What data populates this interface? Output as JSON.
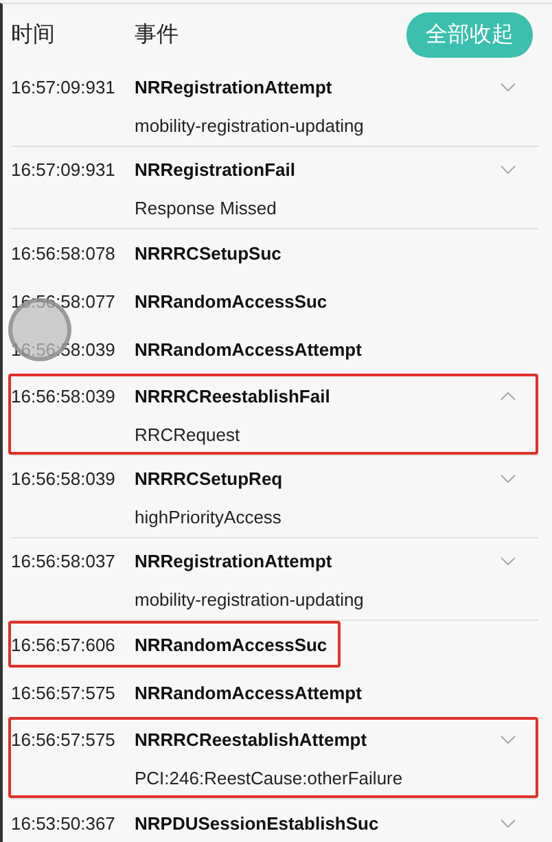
{
  "header": {
    "columns": [
      "时间",
      "事件"
    ],
    "collapse_button": "全部收起"
  },
  "events": [
    {
      "time": "16:57:09:931",
      "name": "NRRegistrationAttempt",
      "detail": "mobility-registration-updating",
      "expandable": true,
      "expanded": false,
      "highlighted": false
    },
    {
      "time": "16:57:09:931",
      "name": "NRRegistrationFail",
      "detail": "Response Missed",
      "expandable": true,
      "expanded": false,
      "highlighted": false
    },
    {
      "time": "16:56:58:078",
      "name": "NRRRCSetupSuc",
      "highlighted": false
    },
    {
      "time": "16:56:58:077",
      "name": "NRRandomAccessSuc",
      "highlighted": false
    },
    {
      "time": "16:56:58:039",
      "name": "NRRandomAccessAttempt",
      "highlighted": false
    },
    {
      "time": "16:56:58:039",
      "name": "NRRRCReestablishFail",
      "detail": "RRCRequest",
      "expandable": true,
      "expanded": true,
      "highlighted": true
    },
    {
      "time": "16:56:58:039",
      "name": "NRRRCSetupReq",
      "detail": "highPriorityAccess",
      "expandable": true,
      "expanded": false,
      "highlighted": false
    },
    {
      "time": "16:56:58:037",
      "name": "NRRegistrationAttempt",
      "detail": "mobility-registration-updating",
      "expandable": true,
      "expanded": false,
      "highlighted": false
    },
    {
      "time": "16:56:57:606",
      "name": "NRRandomAccessSuc",
      "highlighted": true
    },
    {
      "time": "16:56:57:575",
      "name": "NRRandomAccessAttempt",
      "highlighted": false
    },
    {
      "time": "16:56:57:575",
      "name": "NRRRCReestablishAttempt",
      "detail": "PCI:246:ReestCause:otherFailure",
      "expandable": true,
      "expanded": false,
      "highlighted": true
    },
    {
      "time": "16:53:50:367",
      "name": "NRPDUSessionEstablishSuc",
      "expandable": true,
      "expanded": false,
      "highlighted": false
    }
  ]
}
